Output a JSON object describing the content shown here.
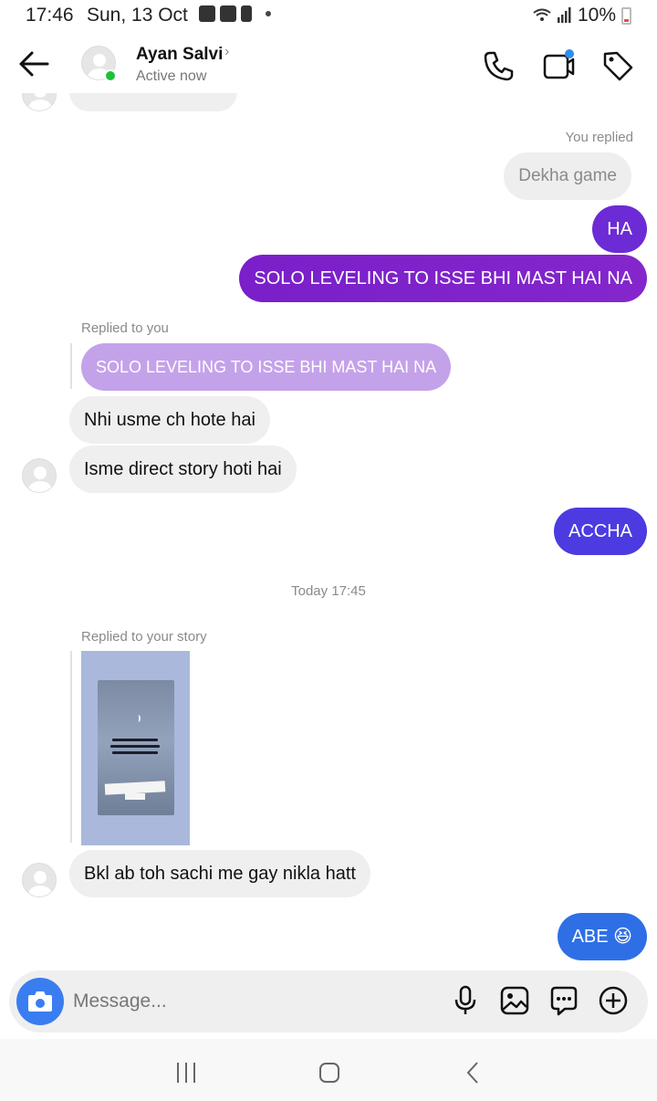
{
  "status_bar": {
    "time": "17:46",
    "date": "Sun, 13 Oct",
    "battery": "10%"
  },
  "header": {
    "contact_name": "Ayan Salvi",
    "status": "Active now",
    "online_color": "#1ec03a"
  },
  "colors": {
    "outgoing_gradient_start": "#7a1fc9",
    "outgoing_gradient_end": "#3a4fe0",
    "incoming_bg": "#efefef",
    "quoted_reply_bg": "#c4a2ea",
    "camera_button": "#3a7df0"
  },
  "messages": {
    "you_replied_label": "You replied",
    "quoted_own": "Dekha game",
    "out_ha": "HA",
    "out_solo": "SOLO LEVELING TO ISSE BHI MAST HAI NA",
    "replied_to_you_label": "Replied to you",
    "quoted_reply": "SOLO LEVELING TO ISSE BHI MAST HAI NA",
    "in_nhi": "Nhi usme ch hote hai",
    "in_isme": "Isme direct story hoti hai",
    "out_accha": "ACCHA",
    "timestamp": "Today 17:45",
    "replied_story_label": "Replied to your story",
    "in_bkl": "Bkl ab toh sachi me gay nikla hatt",
    "out_abe": "ABE 😆"
  },
  "composer": {
    "placeholder": "Message..."
  },
  "icons": {
    "header": [
      "back-arrow-icon",
      "phone-icon",
      "video-camera-icon",
      "tag-icon"
    ],
    "composer": [
      "camera-icon",
      "microphone-icon",
      "image-icon",
      "sticker-icon",
      "plus-icon"
    ],
    "navbar": [
      "recent-apps-icon",
      "home-icon",
      "back-icon"
    ]
  }
}
